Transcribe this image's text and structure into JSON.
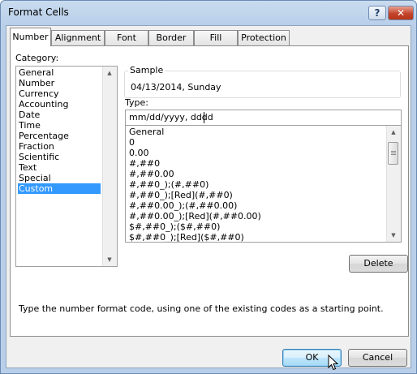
{
  "window": {
    "title": "Format Cells",
    "help_label": "?",
    "close_label": "✕"
  },
  "tabs": [
    {
      "label": "Number",
      "active": true
    },
    {
      "label": "Alignment"
    },
    {
      "label": "Font"
    },
    {
      "label": "Border"
    },
    {
      "label": "Fill"
    },
    {
      "label": "Protection"
    }
  ],
  "category": {
    "label": "Category:",
    "items": [
      "General",
      "Number",
      "Currency",
      "Accounting",
      "Date",
      "Time",
      "Percentage",
      "Fraction",
      "Scientific",
      "Text",
      "Special",
      "Custom"
    ],
    "selected": "Custom"
  },
  "sample": {
    "label": "Sample",
    "value": "04/13/2014, Sunday"
  },
  "type": {
    "label": "Type:",
    "value": "mm/dd/yyyy, dddd",
    "formats": [
      "General",
      "0",
      "0.00",
      "#,##0",
      "#,##0.00",
      "#,##0_);(#,##0)",
      "#,##0_);[Red](#,##0)",
      "#,##0.00_);(#,##0.00)",
      "#,##0.00_);[Red](#,##0.00)",
      "$#,##0_);($#,##0)",
      "$#,##0_);[Red]($#,##0)"
    ]
  },
  "buttons": {
    "delete": "Delete",
    "ok": "OK",
    "cancel": "Cancel"
  },
  "hint": "Type the number format code, using one of the existing codes as a starting point.",
  "icons": {
    "up": "▲",
    "down": "▼"
  },
  "colors": {
    "selection": "#3399ff",
    "close": "#c4442c"
  }
}
